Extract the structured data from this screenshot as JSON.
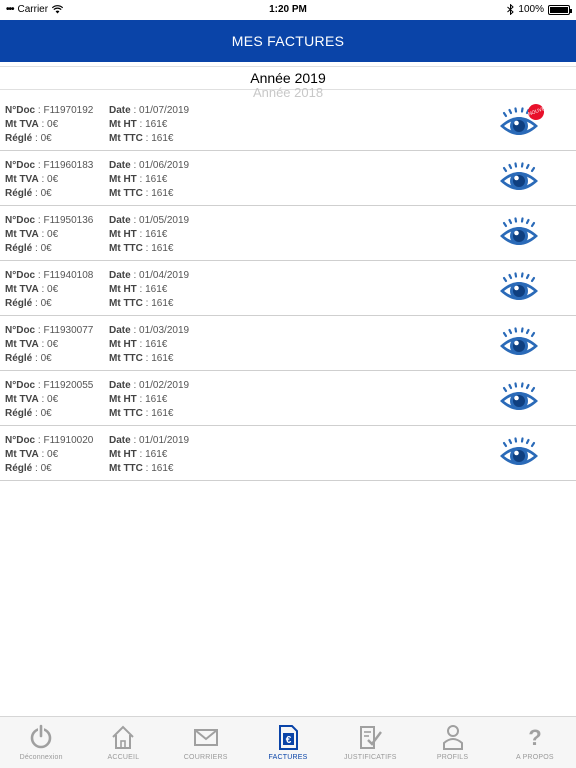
{
  "status_bar": {
    "carrier": "Carrier",
    "time": "1:20 PM",
    "battery": "100%"
  },
  "header": {
    "title": "MES FACTURES"
  },
  "year_picker": {
    "selected": "Année 2019",
    "next": "Année 2018"
  },
  "labels": {
    "ndoc": "N°Doc",
    "date": "Date",
    "mt_tva": "Mt TVA",
    "mt_ht": "Mt HT",
    "regle": "Réglé",
    "mt_ttc": "Mt TTC"
  },
  "badge": {
    "new": "NOUVEAU"
  },
  "invoices": [
    {
      "ndoc": "F11970192",
      "date": "01/07/2019",
      "mt_tva": "0€",
      "mt_ht": "161€",
      "regle": "0€",
      "mt_ttc": "161€",
      "is_new": true
    },
    {
      "ndoc": "F11960183",
      "date": "01/06/2019",
      "mt_tva": "0€",
      "mt_ht": "161€",
      "regle": "0€",
      "mt_ttc": "161€",
      "is_new": false
    },
    {
      "ndoc": "F11950136",
      "date": "01/05/2019",
      "mt_tva": "0€",
      "mt_ht": "161€",
      "regle": "0€",
      "mt_ttc": "161€",
      "is_new": false
    },
    {
      "ndoc": "F11940108",
      "date": "01/04/2019",
      "mt_tva": "0€",
      "mt_ht": "161€",
      "regle": "0€",
      "mt_ttc": "161€",
      "is_new": false
    },
    {
      "ndoc": "F11930077",
      "date": "01/03/2019",
      "mt_tva": "0€",
      "mt_ht": "161€",
      "regle": "0€",
      "mt_ttc": "161€",
      "is_new": false
    },
    {
      "ndoc": "F11920055",
      "date": "01/02/2019",
      "mt_tva": "0€",
      "mt_ht": "161€",
      "regle": "0€",
      "mt_ttc": "161€",
      "is_new": false
    },
    {
      "ndoc": "F11910020",
      "date": "01/01/2019",
      "mt_tva": "0€",
      "mt_ht": "161€",
      "regle": "0€",
      "mt_ttc": "161€",
      "is_new": false
    }
  ],
  "tabs": [
    {
      "label": "Déconnexion",
      "icon": "power-icon",
      "active": false
    },
    {
      "label": "ACCUEIL",
      "icon": "home-icon",
      "active": false
    },
    {
      "label": "COURRIERS",
      "icon": "envelope-icon",
      "active": false
    },
    {
      "label": "FACTURES",
      "icon": "invoice-euro-icon",
      "active": true
    },
    {
      "label": "JUSTIFICATIFS",
      "icon": "document-check-icon",
      "active": false
    },
    {
      "label": "PROFILS",
      "icon": "person-icon",
      "active": false
    },
    {
      "label": "A PROPOS",
      "icon": "question-icon",
      "active": false
    }
  ],
  "colors": {
    "primary": "#0a44a8",
    "eye": "#2a6ab8",
    "badge": "#e8102a",
    "tab_inactive": "#9a9a9a"
  }
}
